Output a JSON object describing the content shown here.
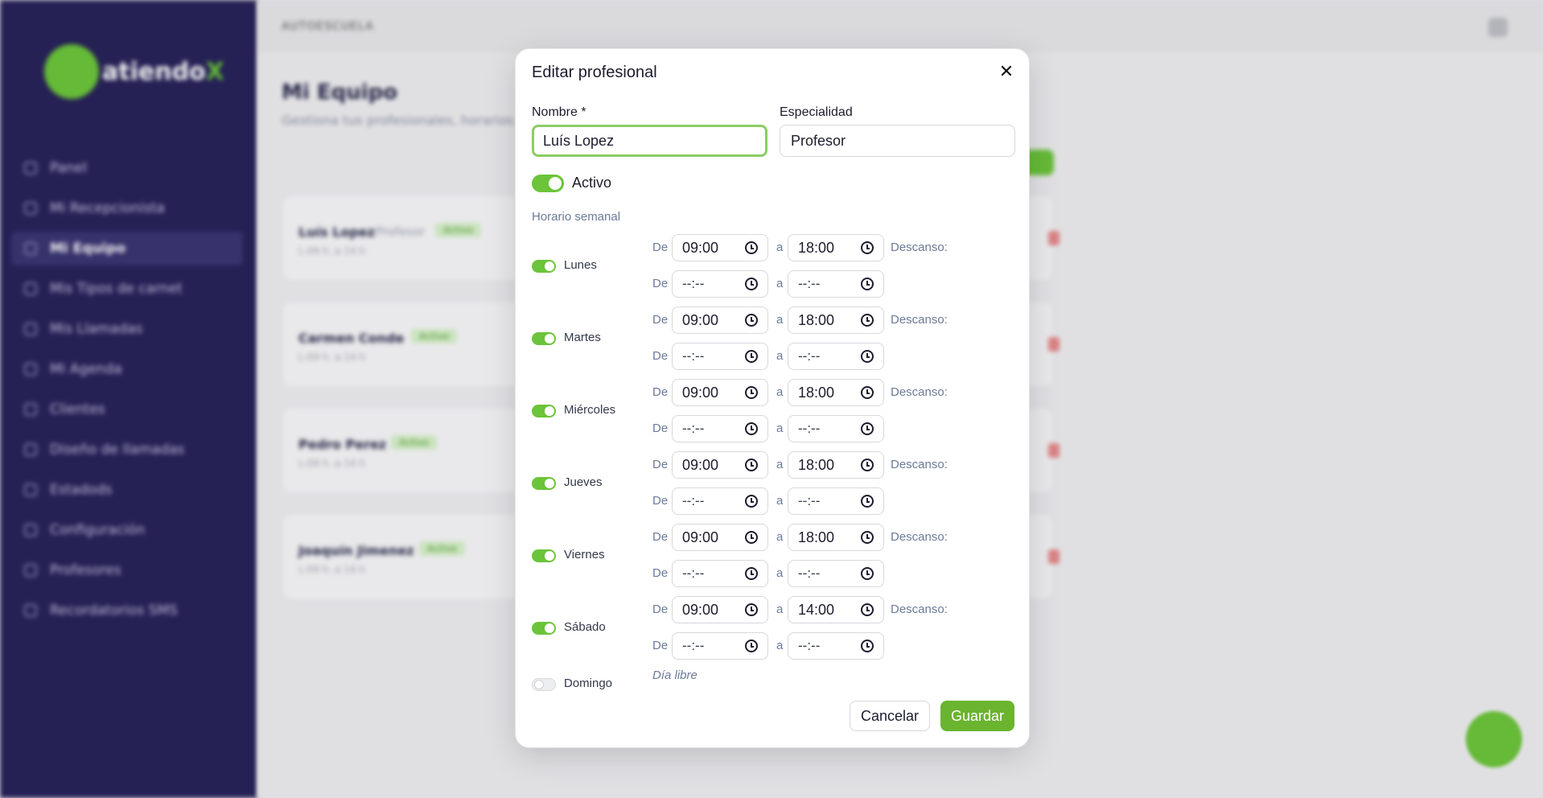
{
  "background": {
    "logo": {
      "text": "atiendo",
      "accent": "X"
    },
    "nav": [
      {
        "label": "Panel"
      },
      {
        "label": "Mi Recepcionista"
      },
      {
        "label": "Mi Equipo",
        "active": true
      },
      {
        "label": "Mis Tipos de carnet"
      },
      {
        "label": "Mis Llamadas"
      },
      {
        "label": "Mi Agenda"
      },
      {
        "label": "Clientes"
      },
      {
        "label": "Diseño de llamadas"
      },
      {
        "label": "Estadods"
      },
      {
        "label": "Configuración"
      },
      {
        "label": "Profesores"
      },
      {
        "label": "Recordatorios SMS"
      }
    ],
    "topbar": {
      "title": "AUTOESCUELA"
    },
    "page": {
      "title": "Mi Equipo",
      "subtitle": "Gestiona tus profesionales, horarios..."
    },
    "cards": [
      {
        "name": "Luís Lopez",
        "specialty": "Profesor",
        "badge": "Activo",
        "meta": "L-09 h. a 14 h"
      },
      {
        "name": "Carmen Conde",
        "specialty": "",
        "badge": "Activo",
        "meta": "L-09 h. a 14 h"
      },
      {
        "name": "Pedro Perez",
        "specialty": "",
        "badge": "Activo",
        "meta": "L-09 h. a 14 h"
      },
      {
        "name": "Joaquín Jimenez",
        "specialty": "",
        "badge": "Activo",
        "meta": "L-09 h. a 14 h"
      }
    ]
  },
  "modal": {
    "title": "Editar profesional",
    "close_icon": "close-icon",
    "name_field": {
      "label": "Nombre *",
      "value": "Luís Lopez"
    },
    "specialty_field": {
      "label": "Especialidad",
      "value": "Profesor"
    },
    "active_toggle": {
      "label": "Activo",
      "on": true
    },
    "schedule_label": "Horario semanal",
    "from_label": "De",
    "to_label": "a",
    "break_label": "Descanso:",
    "empty_time": "--:--",
    "days": [
      {
        "name": "Lunes",
        "on": true,
        "start": "09:00",
        "end": "18:00"
      },
      {
        "name": "Martes",
        "on": true,
        "start": "09:00",
        "end": "18:00"
      },
      {
        "name": "Miércoles",
        "on": true,
        "start": "09:00",
        "end": "18:00"
      },
      {
        "name": "Jueves",
        "on": true,
        "start": "09:00",
        "end": "18:00"
      },
      {
        "name": "Viernes",
        "on": true,
        "start": "09:00",
        "end": "18:00"
      },
      {
        "name": "Sábado",
        "on": true,
        "start": "09:00",
        "end": "14:00"
      },
      {
        "name": "Domingo",
        "on": false,
        "note": "Día libre"
      }
    ],
    "cancel_label": "Cancelar",
    "save_label": "Guardar"
  },
  "colors": {
    "accent": "#6bc43a",
    "sidebar": "#28235a",
    "muted_text": "#6b7a99"
  }
}
